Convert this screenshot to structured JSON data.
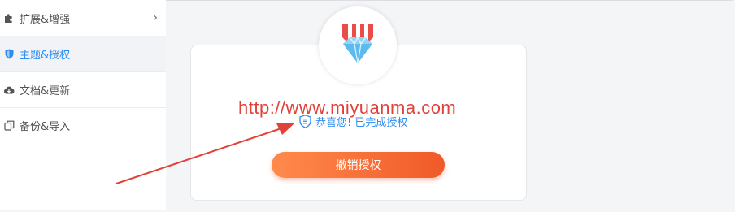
{
  "sidebar": {
    "items": [
      {
        "label": "扩展&增强",
        "icon": "puzzle-icon",
        "has_chevron": true
      },
      {
        "label": "主题&授权",
        "icon": "shield-icon",
        "active": true
      },
      {
        "label": "文档&更新",
        "icon": "cloud-download-icon"
      },
      {
        "label": "备份&导入",
        "icon": "copy-icon"
      }
    ],
    "chevron": "›"
  },
  "license": {
    "badge_icon": "diamond-badge-icon",
    "status_icon": "shield-check-icon",
    "status_text": "恭喜您! 已完成授权",
    "revoke_button": "撤销授权"
  },
  "watermark": {
    "text": "http://www.miyuanma.com"
  },
  "colors": {
    "accent": "#2d8cf0",
    "button_start": "#ff8a4c",
    "button_end": "#f05a28",
    "watermark": "#e0423a",
    "arrow": "#e0423a"
  }
}
